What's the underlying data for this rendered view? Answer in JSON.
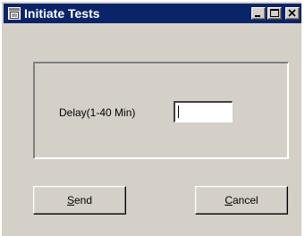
{
  "window": {
    "title": "Initiate Tests",
    "icon": "app-window-icon",
    "controls": [
      "minimize-icon",
      "maximize-icon",
      "close-icon"
    ]
  },
  "form": {
    "delay_label": "Delay(1-40 Min)",
    "delay_value": ""
  },
  "buttons": {
    "send_mnemonic": "S",
    "send_rest": "end",
    "cancel_mnemonic": "C",
    "cancel_rest": "ancel"
  },
  "colors": {
    "titlebar": "#0a246a",
    "face": "#d4d0c8"
  }
}
